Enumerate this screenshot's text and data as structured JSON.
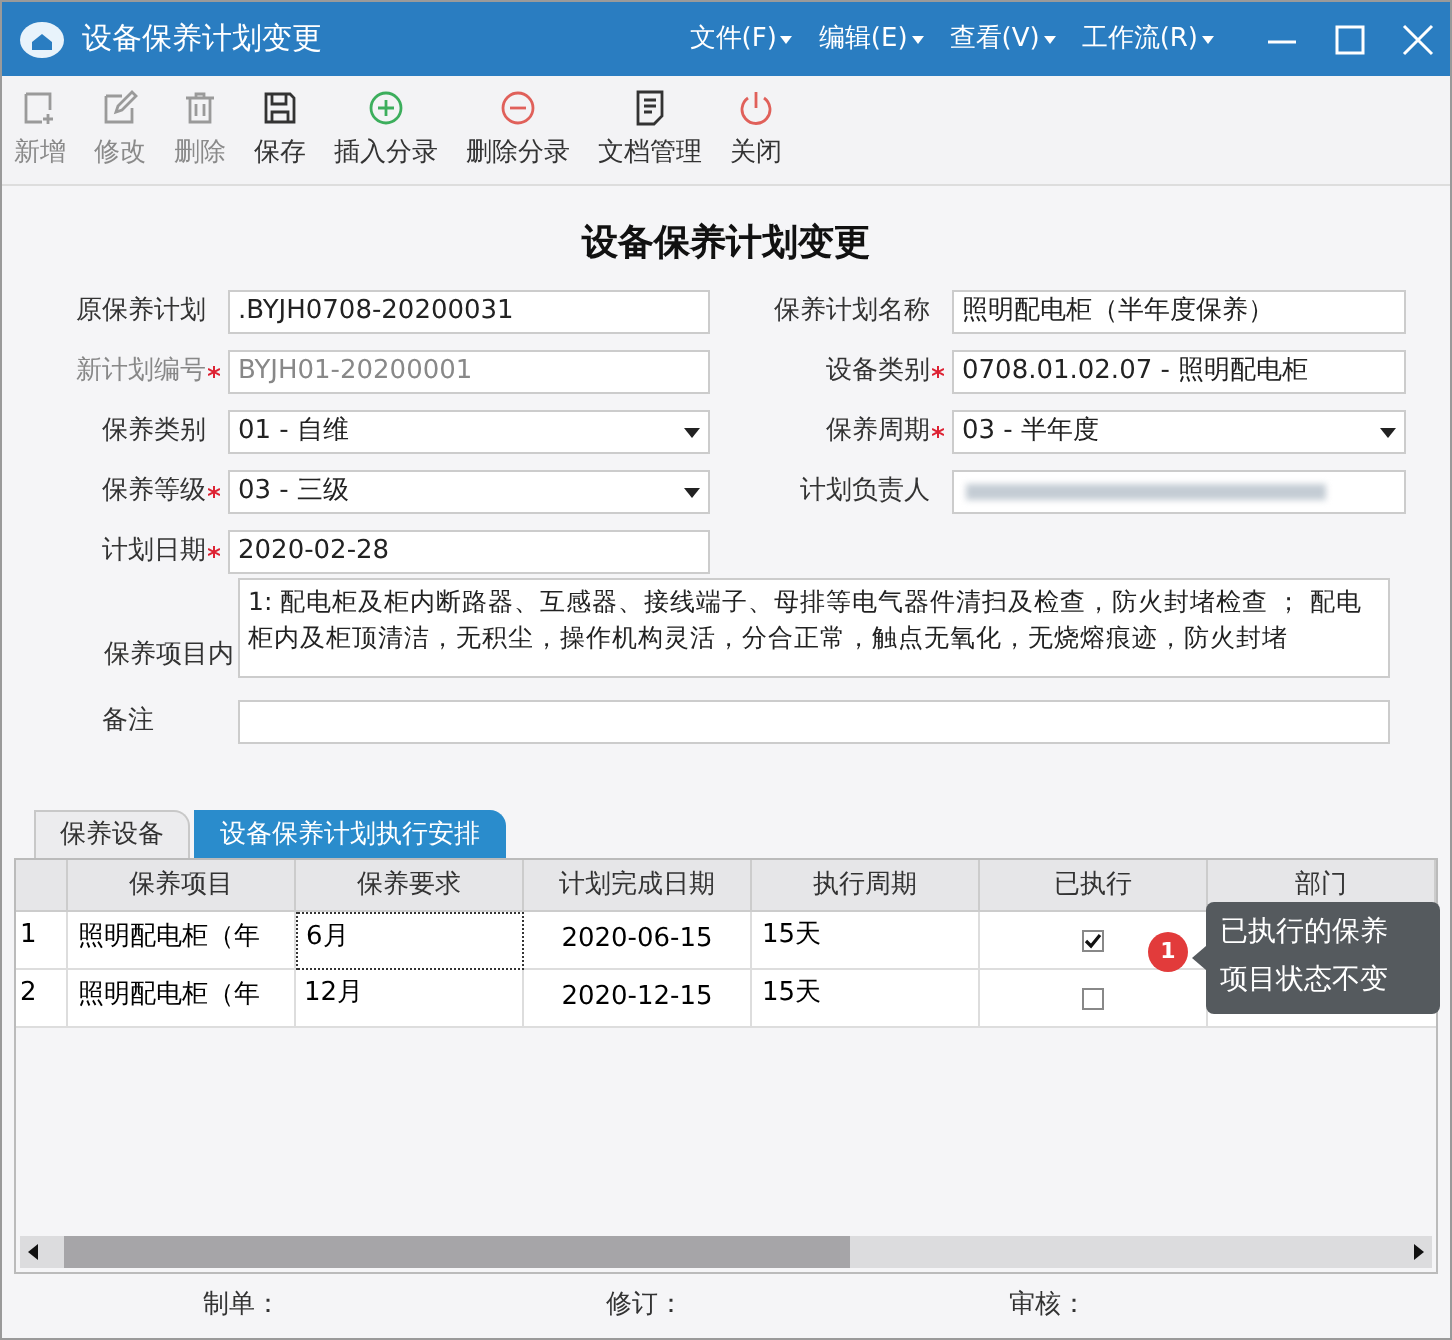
{
  "window": {
    "title": "设备保养计划变更"
  },
  "menu": [
    {
      "label": "文件(F)"
    },
    {
      "label": "编辑(E)"
    },
    {
      "label": "查看(V)"
    },
    {
      "label": "工作流(R)"
    }
  ],
  "toolbar": [
    {
      "label": "新增",
      "kind": "add",
      "disabled": true
    },
    {
      "label": "修改",
      "kind": "edit",
      "disabled": true
    },
    {
      "label": "删除",
      "kind": "trash",
      "disabled": true
    },
    {
      "label": "保存",
      "kind": "save",
      "disabled": false
    },
    {
      "label": "插入分录",
      "kind": "plus",
      "disabled": false
    },
    {
      "label": "删除分录",
      "kind": "minus",
      "disabled": false
    },
    {
      "label": "文档管理",
      "kind": "doc",
      "disabled": false
    },
    {
      "label": "关闭",
      "kind": "power",
      "disabled": false
    }
  ],
  "heading": "设备保养计划变更",
  "form_rows": [
    {
      "left": {
        "label": "原保养计划",
        "kind": "text",
        "value": ".BYJH0708-20200031",
        "required": false,
        "disabled": false
      },
      "right": {
        "label": "保养计划名称",
        "kind": "text",
        "value": "照明配电柜（半年度保养）",
        "required": false,
        "disabled": false
      }
    },
    {
      "left": {
        "label": "新计划编号",
        "kind": "text",
        "value": "BYJH01-20200001",
        "required": true,
        "disabled": true
      },
      "right": {
        "label": "设备类别",
        "kind": "text",
        "value": "0708.01.02.07 - 照明配电柜",
        "required": true,
        "disabled": false
      }
    },
    {
      "left": {
        "label": "保养类别",
        "kind": "select",
        "value": "01 - 自维",
        "required": false
      },
      "right": {
        "label": "保养周期",
        "kind": "select",
        "value": "03 - 半年度",
        "required": true
      }
    },
    {
      "left": {
        "label": "保养等级",
        "kind": "select",
        "value": "03 - 三级",
        "required": true
      },
      "right": {
        "label": "计划负责人",
        "kind": "redacted",
        "required": false
      }
    },
    {
      "left": {
        "label": "计划日期",
        "kind": "text",
        "value": "2020-02-28",
        "required": true,
        "disabled": false
      }
    }
  ],
  "content": {
    "label": "保养项目内",
    "value": "1: 配电柜及柜内断路器、互感器、接线端子、母排等电气器件清扫及检查，防火封堵检查 ； 配电柜内及柜顶清洁，无积尘，操作机构灵活，分合正常，触点无氧化，无烧熔痕迹，防火封堵"
  },
  "notes": {
    "label": "备注"
  },
  "tabs": [
    {
      "label": "保养设备",
      "selected": false
    },
    {
      "label": "设备保养计划执行安排",
      "selected": true
    }
  ],
  "table": {
    "columns": [
      "保养项目",
      "保养要求",
      "计划完成日期",
      "执行周期",
      "已执行",
      "部门"
    ],
    "rows": [
      {
        "index": "1",
        "item": "照明配电柜（年",
        "requirement": "6月",
        "date": "2020-06-15",
        "cycle": "15天",
        "executed": true,
        "selected": true
      },
      {
        "index": "2",
        "item": "照明配电柜（年",
        "requirement": "12月",
        "date": "2020-12-15",
        "cycle": "15天",
        "executed": false,
        "selected": false
      }
    ]
  },
  "callout": {
    "number": "1",
    "text": "已执行的保养项目状态不变"
  },
  "footer": [
    {
      "label": "制单："
    },
    {
      "label": "修订："
    },
    {
      "label": "审核："
    }
  ]
}
